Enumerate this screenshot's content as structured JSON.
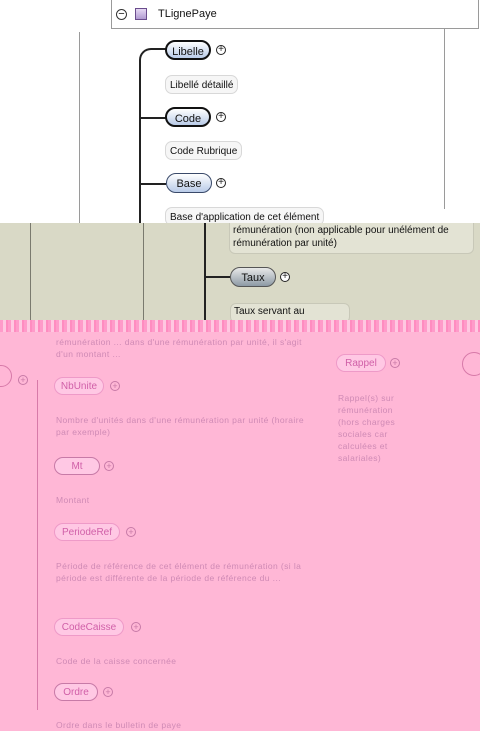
{
  "header": {
    "title": "TLignePaye"
  },
  "top_nodes": [
    {
      "label": "Libelle",
      "desc": "Libellé détaillé"
    },
    {
      "label": "Code",
      "desc": "Code Rubrique"
    },
    {
      "label": "Base",
      "desc": "Base d'application de cet élément"
    }
  ],
  "middle": {
    "desc_lines": [
      "rémunération (non applicable pour unélément de",
      "rémunération par unité)"
    ],
    "node": "Taux",
    "taux_desc": "Taux servant au"
  },
  "bottom": {
    "intro": "rémunération ... dans d'une rémunération par unité, il s'agit d'un montant ...",
    "nodes": [
      {
        "label": "NbUnite",
        "desc": "Nombre d'unités dans d'une rémunération par unité (horaire par exemple)"
      },
      {
        "label": "Mt",
        "desc": "Montant"
      },
      {
        "label": "PeriodeRef",
        "desc": "Période de référence de cet élément de rémunération (si la période est différente de la période de référence du ..."
      },
      {
        "label": "CodeCaisse",
        "desc": "Code de la caisse concernée"
      },
      {
        "label": "Ordre",
        "desc": "Ordre dans le bulletin de paye"
      }
    ],
    "rappel": {
      "label": "Rappel",
      "desc": "Rappel(s) sur rémunération (hors charges sociales car calculées et salariales)"
    }
  }
}
